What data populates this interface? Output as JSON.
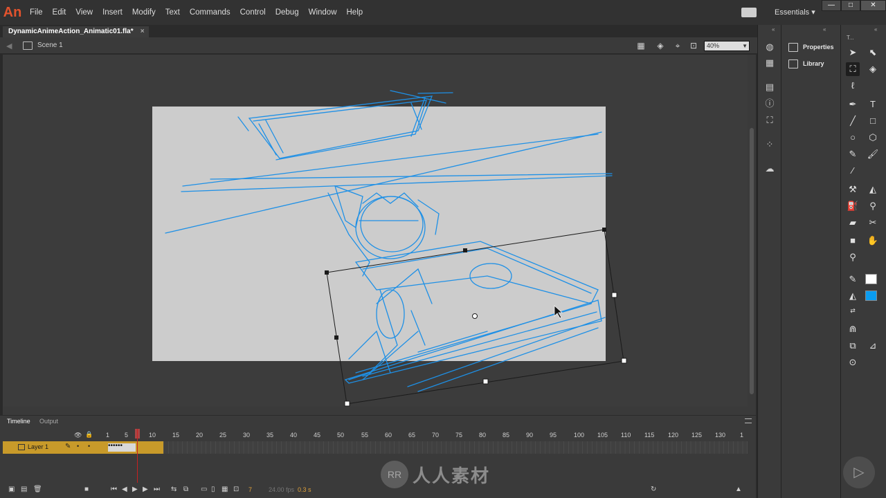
{
  "app": {
    "logo": "An"
  },
  "menu": [
    "File",
    "Edit",
    "View",
    "Insert",
    "Modify",
    "Text",
    "Commands",
    "Control",
    "Debug",
    "Window",
    "Help"
  ],
  "workspace": "Essentials",
  "window_controls": [
    "—",
    "□",
    "✕"
  ],
  "document": {
    "tab": "DynamicAnimeAction_Animatic01.fla*",
    "close": "×"
  },
  "editbar": {
    "scene": "Scene 1",
    "zoom": "40%"
  },
  "timeline": {
    "tabs": [
      "Timeline",
      "Output"
    ],
    "frame_numbers": [
      "1",
      "5",
      "10",
      "15",
      "20",
      "25",
      "30",
      "35",
      "40",
      "45",
      "50",
      "55",
      "60",
      "65",
      "70",
      "75",
      "80",
      "85",
      "90",
      "95",
      "100",
      "105",
      "110",
      "115",
      "120",
      "125",
      "130",
      "1"
    ],
    "layer": "Layer 1",
    "current_frame": "7",
    "fps": "24.00 fps",
    "time": "0.3 s"
  },
  "panels": {
    "properties": "Properties",
    "library": "Library"
  },
  "watermark": {
    "text": "人人素材"
  }
}
